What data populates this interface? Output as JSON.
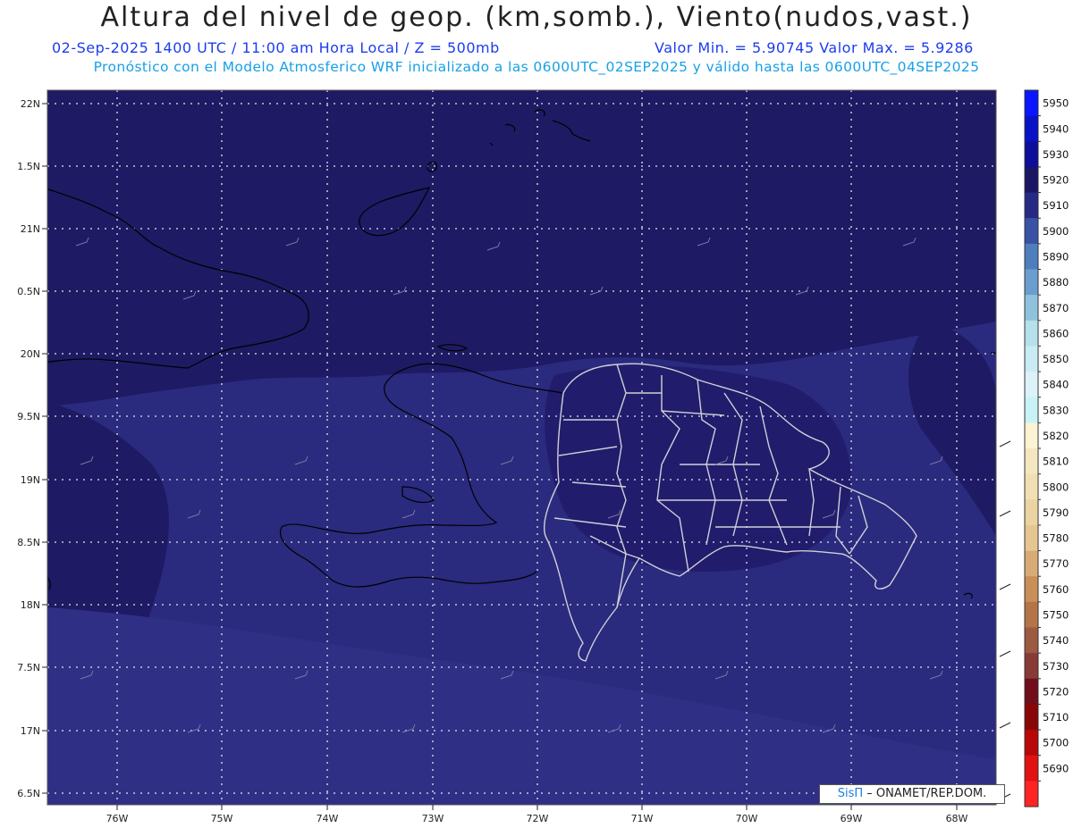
{
  "header": {
    "title": "Altura del nivel de geop. (km,somb.), Viento(nudos,vast.)",
    "subtitle_left": "02-Sep-2025  1400 UTC / 11:00 am Hora Local / Z = 500mb",
    "subtitle_right": "Valor Min. = 5.90745  Valor Max. = 5.9286",
    "subtitle2": "Pronóstico con el Modelo Atmosferico WRF inicializado a las 0600UTC_02SEP2025 y válido hasta las  0600UTC_04SEP2025"
  },
  "map": {
    "lat_ticks": [
      "22N",
      "1.5N",
      "21N",
      "0.5N",
      "20N",
      "9.5N",
      "19N",
      "8.5N",
      "18N",
      "7.5N",
      "17N",
      "6.5N"
    ],
    "lon_ticks": [
      "76W",
      "75W",
      "74W",
      "73W",
      "72W",
      "71W",
      "70W",
      "69W",
      "68W"
    ],
    "background_color": "#2a2a7e",
    "coast_color": "#000000",
    "border_color": "#cfcfd8"
  },
  "colorbar": {
    "levels": [
      "5950",
      "5940",
      "5930",
      "5920",
      "5910",
      "5900",
      "5890",
      "5880",
      "5870",
      "5860",
      "5850",
      "5840",
      "5830",
      "5820",
      "5810",
      "5800",
      "5790",
      "5780",
      "5770",
      "5760",
      "5750",
      "5740",
      "5730",
      "5720",
      "5710",
      "5700",
      "5690"
    ],
    "colors": [
      "#0a16ff",
      "#0a12c8",
      "#0e0e9a",
      "#1a1664",
      "#262a84",
      "#3a52a6",
      "#4f7ebf",
      "#6a9ece",
      "#8fc2dd",
      "#b5e0ec",
      "#c9ebf3",
      "#daf2f8",
      "#c8f3f6",
      "#fbf3d2",
      "#f4e7c0",
      "#f0dfb2",
      "#ebd3a2",
      "#e6c690",
      "#d9ab74",
      "#c88f59",
      "#b57448",
      "#9c5a40",
      "#873a36",
      "#700e1c",
      "#8a0606",
      "#b80808",
      "#e01212",
      "#ff2424"
    ]
  },
  "credit": {
    "brand": "SisΠ",
    "text": " –  ONAMET/REP.DOM."
  }
}
